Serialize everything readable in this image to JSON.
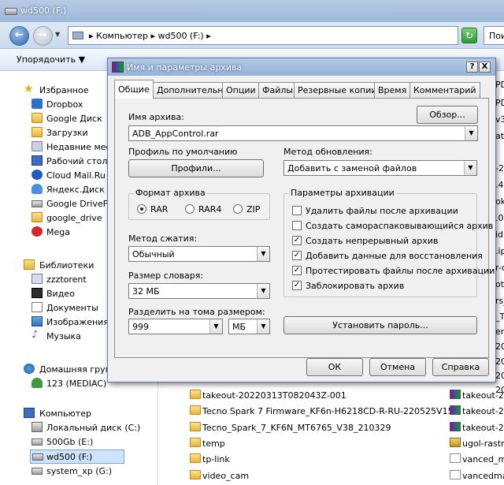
{
  "explorer": {
    "title": "wd500 (F:)",
    "address": "▸ Компьютер ▸ wd500 (F:) ▸",
    "search_placeholder": "Пои",
    "organize_label": "Упорядочить ▼"
  },
  "sidebar": {
    "favorites": [
      {
        "label": "Избранное",
        "icon": "star-icon"
      },
      {
        "label": "Dropbox",
        "icon": "dropbox-icon"
      },
      {
        "label": "Google Диск",
        "icon": "folder-icon"
      },
      {
        "label": "Загрузки",
        "icon": "folder-icon"
      },
      {
        "label": "Недавние мест",
        "icon": "recent-places-icon"
      },
      {
        "label": "Рабочий стол",
        "icon": "desktop-icon"
      },
      {
        "label": "Cloud Mail.Ru",
        "icon": "cloud-icon"
      },
      {
        "label": "Яндекс.Диск",
        "icon": "yandex-disk-icon"
      },
      {
        "label": "Google DriveFS",
        "icon": "drive-icon"
      },
      {
        "label": "google_drive",
        "icon": "folder-icon"
      },
      {
        "label": "Mega",
        "icon": "mega-icon"
      }
    ],
    "libraries": [
      {
        "label": "Библиотеки",
        "icon": "library-icon"
      },
      {
        "label": "zzztorent",
        "icon": "library-folder-icon"
      },
      {
        "label": "Видео",
        "icon": "video-icon"
      },
      {
        "label": "Документы",
        "icon": "documents-icon"
      },
      {
        "label": "Изображения",
        "icon": "pictures-icon"
      },
      {
        "label": "Музыка",
        "icon": "music-icon"
      }
    ],
    "homegroup": [
      {
        "label": "Домашняя группа",
        "icon": "homegroup-icon"
      },
      {
        "label": "123 (MEDIAC)",
        "icon": "user-icon"
      }
    ],
    "computer": [
      {
        "label": "Компьютер",
        "icon": "computer-icon"
      },
      {
        "label": "Локальный диск (C:)",
        "icon": "local-disk-icon"
      },
      {
        "label": "500Gb (E:)",
        "icon": "drive-icon"
      },
      {
        "label": "wd500 (F:)",
        "icon": "drive-icon"
      },
      {
        "label": "system_xp (G:)",
        "icon": "drive-icon"
      }
    ]
  },
  "files": [
    {
      "name": "takeout-20220313T082043Z-001",
      "icon": "folder-icon"
    },
    {
      "name": "Tecno Spark 7 Firmware_KF6n-H6218CD-R-RU-220525V154",
      "icon": "folder-icon"
    },
    {
      "name": "Tecno_Spark_7_KF6N_MT6765_V38_210329",
      "icon": "folder-icon"
    },
    {
      "name": "temp",
      "icon": "folder-icon"
    },
    {
      "name": "tp-link",
      "icon": "folder-icon"
    },
    {
      "name": "video_cam",
      "icon": "folder-icon"
    }
  ],
  "files_right": [
    {
      "name": "takeout-202",
      "icon": "rar-icon"
    },
    {
      "name": "takeout-202",
      "icon": "rar-icon"
    },
    {
      "name": "takeout-202",
      "icon": "rar-icon"
    },
    {
      "name": "ugol-rastra",
      "icon": "jpg-icon"
    },
    {
      "name": "vanced_ma",
      "icon": "document-icon"
    },
    {
      "name": "vancedman",
      "icon": "document-icon"
    }
  ],
  "right_column_fragments": [
    "PD",
    "PD",
    "v3",
    "ate",
    "",
    "-20",
    ".4",
    "ok",
    ".0",
    "id(",
    ".ip",
    "r-c",
    "ot",
    "rs_",
    "_T",
    "er",
    "20",
    "20",
    "20",
    "20"
  ],
  "dialog": {
    "title": "Имя и параметры архива",
    "help_button": "?",
    "close_button": "X",
    "tabs": [
      "Общие",
      "Дополнительно",
      "Опции",
      "Файлы",
      "Резервные копии",
      "Время",
      "Комментарий"
    ],
    "archive_name_label": "Имя архива:",
    "browse_button": "Обзор...",
    "archive_name_value": "ADB_AppControl.rar",
    "default_profile_label": "Профиль по умолчанию",
    "profiles_button": "Профили...",
    "update_method_label": "Метод обновления:",
    "update_method_value": "Добавить с заменой файлов",
    "archive_format_label": "Формат архива",
    "formats": [
      {
        "label": "RAR",
        "selected": true
      },
      {
        "label": "RAR4",
        "selected": false
      },
      {
        "label": "ZIP",
        "selected": false
      }
    ],
    "compression_label": "Метод сжатия:",
    "compression_value": "Обычный",
    "dictionary_label": "Размер словаря:",
    "dictionary_value": "32 МБ",
    "split_label": "Разделить на тома размером:",
    "split_value": "999",
    "split_unit": "МБ",
    "archive_options_label": "Параметры архивации",
    "options": [
      {
        "label": "Удалить файлы после архивации",
        "checked": false
      },
      {
        "label": "Создать самораспаковывающийся архив",
        "checked": false
      },
      {
        "label": "Создать непрерывный архив",
        "checked": true
      },
      {
        "label": "Добавить данные для восстановления",
        "checked": true
      },
      {
        "label": "Протестировать файлы после архивации",
        "checked": true
      },
      {
        "label": "Заблокировать архив",
        "checked": true
      }
    ],
    "set_password_button": "Установить пароль...",
    "ok_button": "ОК",
    "cancel_button": "Отмена",
    "help_button_label": "Справка"
  }
}
